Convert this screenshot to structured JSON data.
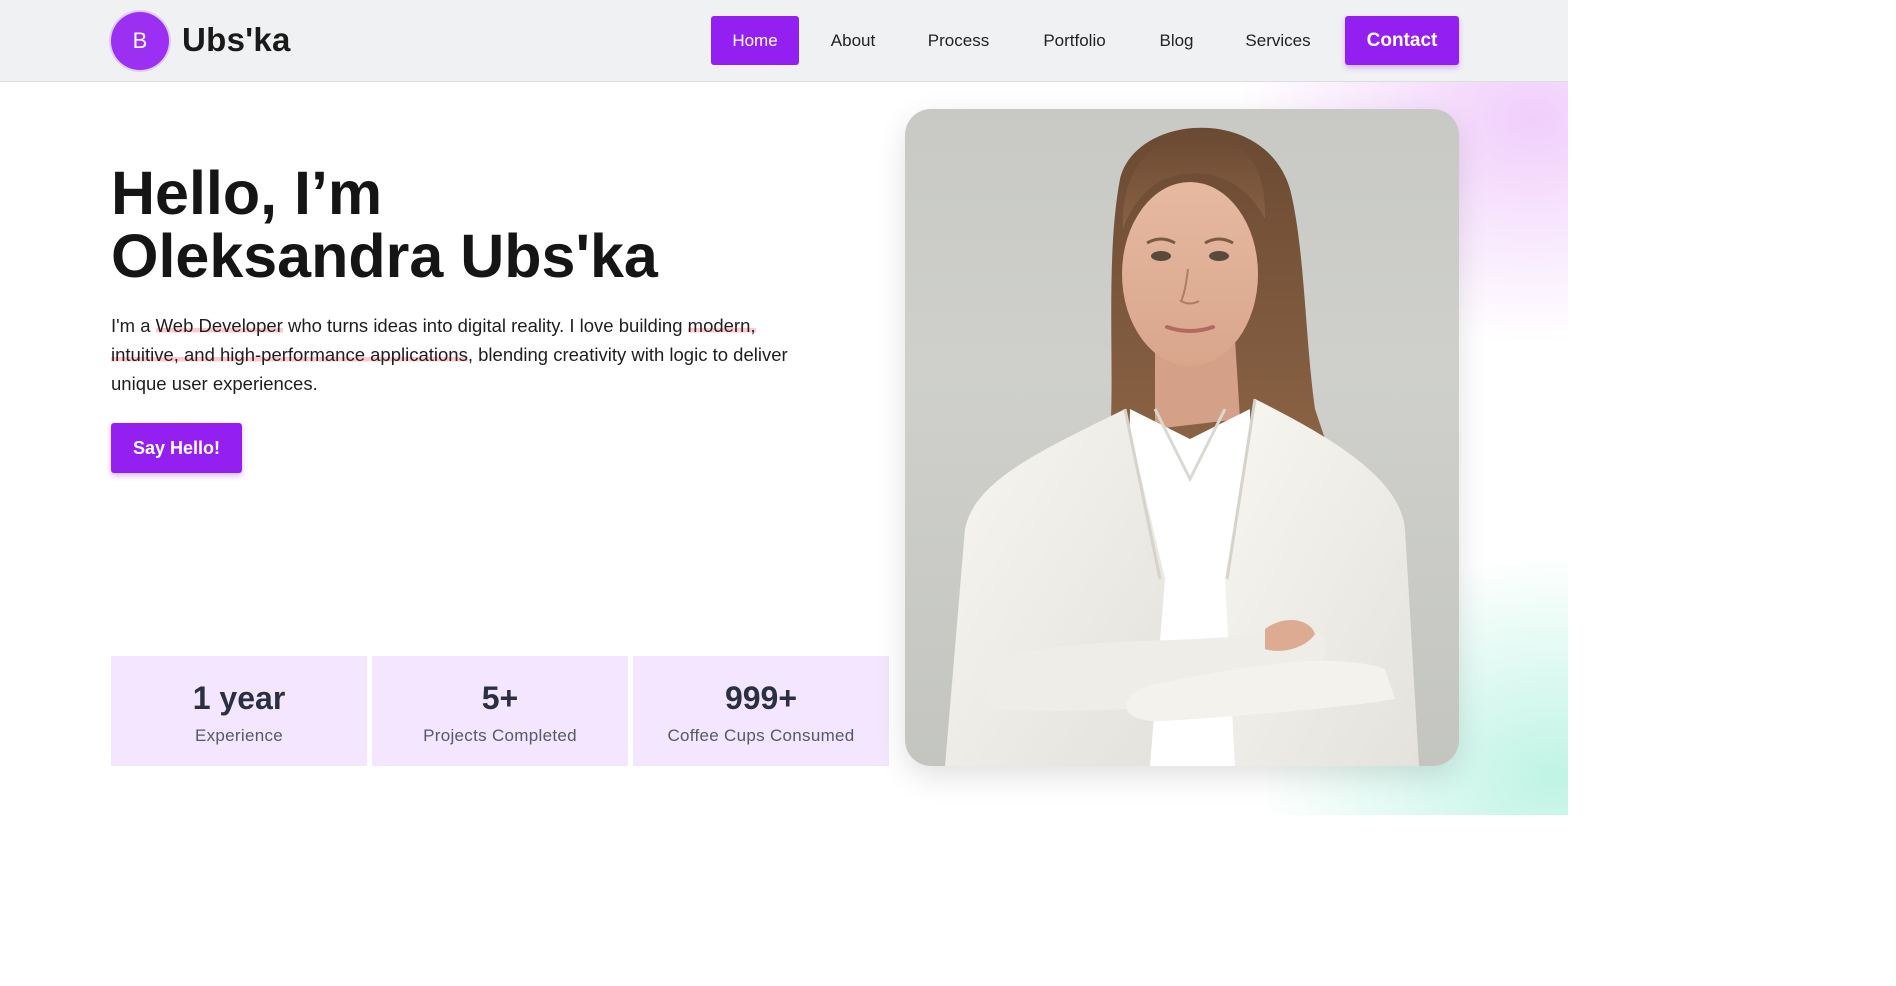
{
  "header": {
    "logo_letter": "B",
    "brand": "Ubs'ka",
    "nav": [
      {
        "label": "Home",
        "active": true
      },
      {
        "label": "About",
        "active": false
      },
      {
        "label": "Process",
        "active": false
      },
      {
        "label": "Portfolio",
        "active": false
      },
      {
        "label": "Blog",
        "active": false
      },
      {
        "label": "Services",
        "active": false
      }
    ],
    "contact_label": "Contact"
  },
  "hero": {
    "title_line1": "Hello, I’m",
    "title_line2": "Oleksandra Ubs'ka",
    "desc_part1": "I'm a ",
    "desc_highlight1": "Web Developer",
    "desc_part2": " who turns ideas into digital reality. I love building ",
    "desc_highlight2": "modern, intuitive, and high-performance applications",
    "desc_part3": ", blending creativity with logic to deliver unique user experiences.",
    "cta_label": "Say Hello!"
  },
  "stats": [
    {
      "value": "1 year",
      "label": "Experience"
    },
    {
      "value": "5+",
      "label": "Projects Completed"
    },
    {
      "value": "999+",
      "label": "Coffee Cups Consumed"
    }
  ],
  "colors": {
    "accent": "#9320f0",
    "stat_bg": "#f3e6fe",
    "header_bg": "#f0f1f3",
    "highlight": "#ffc9d0"
  }
}
